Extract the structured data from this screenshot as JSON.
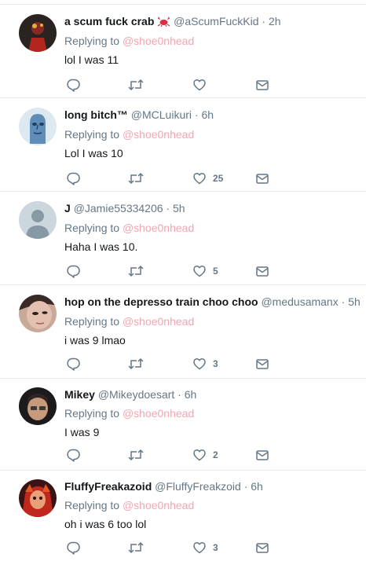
{
  "reply_prefix": "Replying to",
  "separator": "·",
  "tweets": [
    {
      "name": "a scum fuck crab",
      "emoji": "crab-emoji",
      "handle": "@aScumFuckKid",
      "time": "2h",
      "replying_to": "@shoe0nhead",
      "text": "lol I was 11",
      "likes": ""
    },
    {
      "name": "long bitch™",
      "handle": "@MCLuikuri",
      "time": "6h",
      "replying_to": "@shoe0nhead",
      "text": "Lol I was 10",
      "likes": "25"
    },
    {
      "name": "J",
      "handle": "@Jamie55334206",
      "time": "5h",
      "replying_to": "@shoe0nhead",
      "text": "Haha I was 10.",
      "likes": "5"
    },
    {
      "name": "hop on the depresso train choo choo",
      "handle": "@medusamanx",
      "time": "5h",
      "replying_to": "@shoe0nhead",
      "text": "i was 9 lmao",
      "likes": "3"
    },
    {
      "name": "Mikey",
      "handle": "@Mikeydoesart",
      "time": "6h",
      "replying_to": "@shoe0nhead",
      "text": "I was 9",
      "likes": "2"
    },
    {
      "name": "FluffyFreakazoid",
      "handle": "@FluffyFreakzoid",
      "time": "6h",
      "replying_to": "@shoe0nhead",
      "text": "oh i was 6 too lol",
      "likes": "3"
    }
  ],
  "colors": {
    "text": "#14171a",
    "secondary": "#657786",
    "mention": "#f3a4b0",
    "divider": "#e6ecf0"
  },
  "icons": [
    "reply-icon",
    "retweet-icon",
    "like-icon",
    "message-icon"
  ]
}
